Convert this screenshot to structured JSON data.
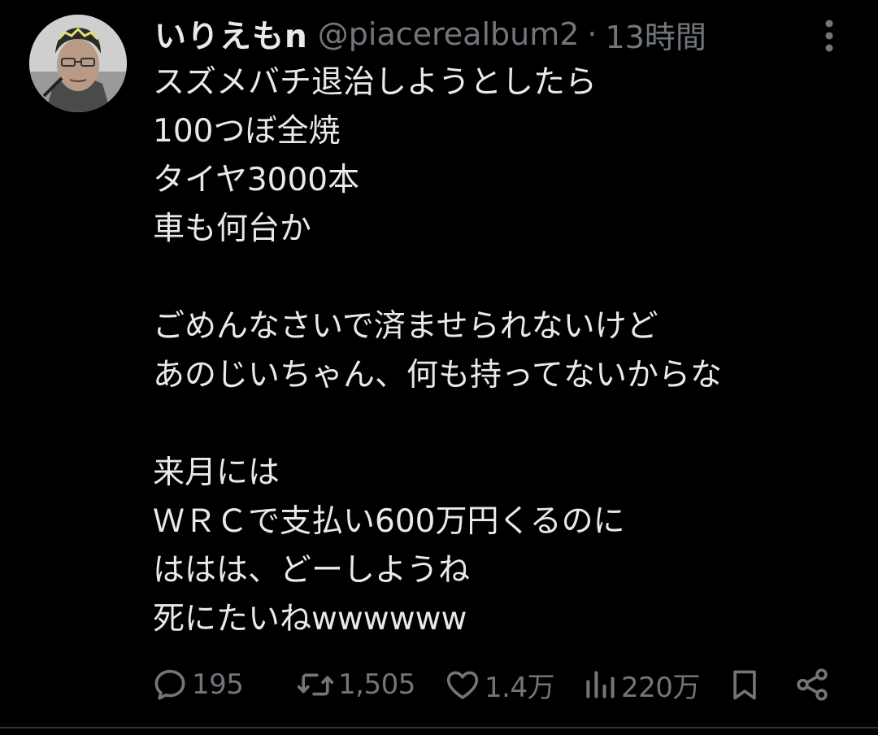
{
  "tweet": {
    "display_name": "いりえもn",
    "handle": "@piacerealbum2",
    "separator": "·",
    "time": "13時間",
    "lines": [
      "スズメバチ退治しようとしたら",
      "100つぼ全焼",
      "タイヤ3000本",
      "車も何台か",
      "",
      "ごめんなさいで済ませられないけど",
      "あのじいちゃん、何も持ってないからな",
      "",
      "来月には",
      "ＷＲＣで支払い600万円くるのに",
      "ははは、どーしようね",
      "死にたいねwwwwww"
    ]
  },
  "actions": {
    "reply_count": "195",
    "retweet_count": "1,505",
    "like_count": "1.4万",
    "view_count": "220万"
  },
  "icons": {
    "more": "more-vertical-icon",
    "reply": "reply-bubble-icon",
    "retweet": "retweet-icon",
    "like": "heart-icon",
    "views": "views-bar-chart-icon",
    "bookmark": "bookmark-icon",
    "share": "share-icon"
  },
  "colors": {
    "background": "#000000",
    "text": "#e7e9ea",
    "secondary": "#71767b"
  }
}
